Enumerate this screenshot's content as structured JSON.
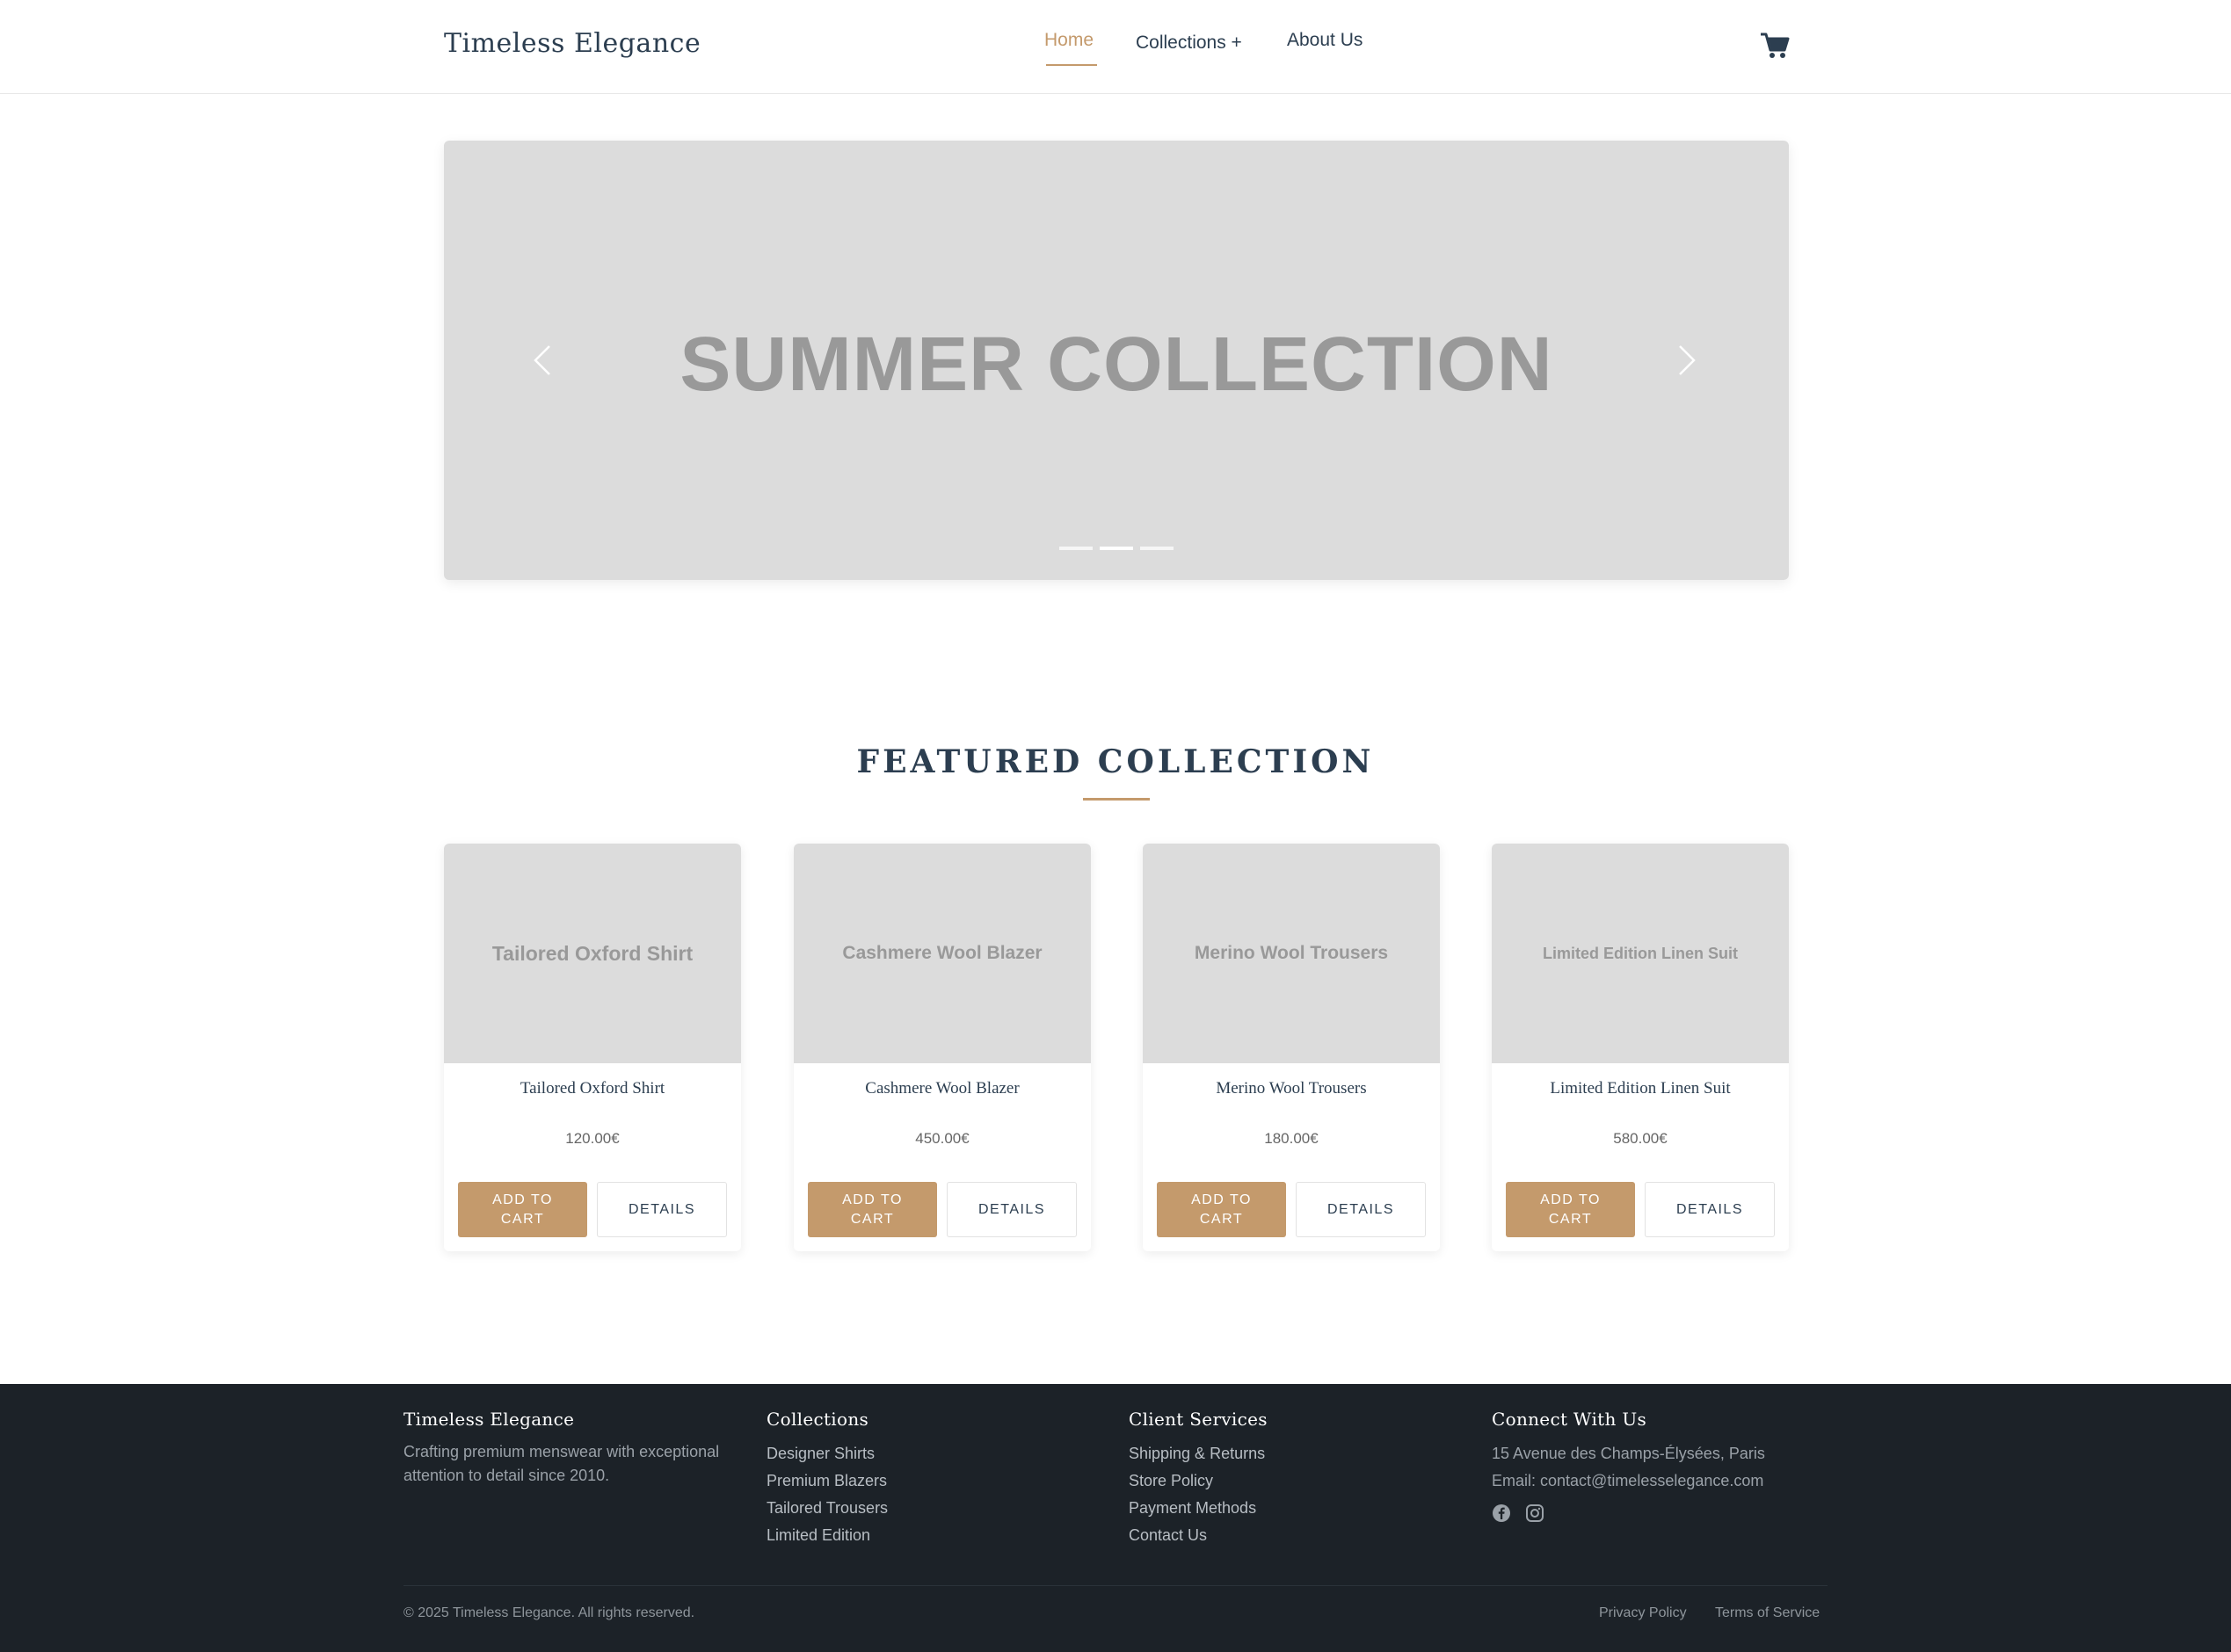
{
  "header": {
    "logo": "Timeless Elegance",
    "nav": {
      "home": "Home",
      "collections": "Collections +",
      "about": "About Us"
    },
    "cart_icon": "shopping-cart-icon",
    "accent_color": "#c49a6c"
  },
  "hero": {
    "title": "SUMMER COLLECTION",
    "prev_icon": "chevron-left-icon",
    "next_icon": "chevron-right-icon",
    "slide_count": 3,
    "active_slide": 2
  },
  "featured": {
    "title": "FEATURED COLLECTION",
    "products": [
      {
        "image_text": "Tailored Oxford Shirt",
        "name": "Tailored Oxford Shirt",
        "price": "120.00€",
        "add_label": "ADD TO CART",
        "details_label": "DETAILS"
      },
      {
        "image_text": "Cashmere Wool Blazer",
        "name": "Cashmere Wool Blazer",
        "price": "450.00€",
        "add_label": "ADD TO CART",
        "details_label": "DETAILS"
      },
      {
        "image_text": "Merino Wool Trousers",
        "name": "Merino Wool Trousers",
        "price": "180.00€",
        "add_label": "ADD TO CART",
        "details_label": "DETAILS"
      },
      {
        "image_text": "Limited Edition Linen Suit",
        "name": "Limited Edition Linen Suit",
        "price": "580.00€",
        "add_label": "ADD TO CART",
        "details_label": "DETAILS"
      }
    ]
  },
  "footer": {
    "brand": {
      "heading": "Timeless Elegance",
      "text": "Crafting premium menswear with exceptional attention to detail since 2010."
    },
    "collections": {
      "heading": "Collections",
      "links": [
        "Designer Shirts",
        "Premium Blazers",
        "Tailored Trousers",
        "Limited Edition"
      ]
    },
    "services": {
      "heading": "Client Services",
      "links": [
        "Shipping & Returns",
        "Store Policy",
        "Payment Methods",
        "Contact Us"
      ]
    },
    "connect": {
      "heading": "Connect With Us",
      "address": "15 Avenue des Champs-Élysées, Paris",
      "email": "Email: contact@timelesselegance.com",
      "icons": [
        "facebook-icon",
        "instagram-icon"
      ]
    },
    "copyright": "© 2025 Timeless Elegance. All rights reserved.",
    "legal": {
      "privacy": "Privacy Policy",
      "terms": "Terms of Service"
    }
  }
}
